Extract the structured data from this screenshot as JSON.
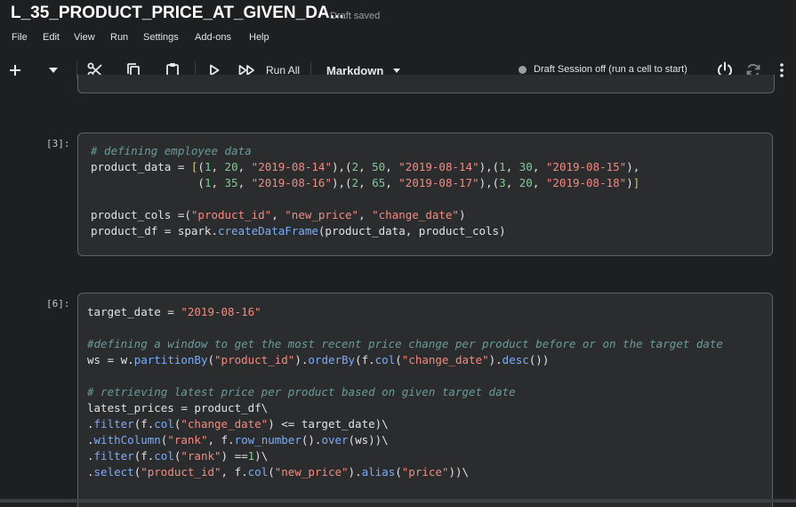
{
  "window": {
    "title": "L_35_PRODUCT_PRICE_AT_GIVEN_DA...",
    "status": "Draft saved"
  },
  "menu": [
    "File",
    "Edit",
    "View",
    "Run",
    "Settings",
    "Add-ons",
    "Help"
  ],
  "toolbar": {
    "add_icon": "plus-icon",
    "run_all_label": "Run All",
    "cell_type": "Markdown",
    "session_text": "Draft Session off (run a cell to start)"
  },
  "cells": [
    {
      "exec_label": "[3]:",
      "lines": [
        "# defining employee data",
        "product_data = [(1, 20, \"2019-08-14\"),(2, 50, \"2019-08-14\"),(1, 30, \"2019-08-15\"),",
        "                (1, 35, \"2019-08-16\"),(2, 65, \"2019-08-17\"),(3, 20, \"2019-08-18\")]",
        "",
        "product_cols =(\"product_id\", \"new_price\", \"change_date\")",
        "product_df = spark.createDataFrame(product_data, product_cols)"
      ]
    },
    {
      "exec_label": "[6]:",
      "lines": [
        "target_date = \"2019-08-16\"",
        "",
        "#defining a window to get the most recent price change per product before or on the target date",
        "ws = w.partitionBy(\"product_id\").orderBy(f.col(\"change_date\").desc())",
        "",
        "# retrieving latest price per product based on given target date",
        "latest_prices = product_df\\",
        ".filter(f.col(\"change_date\") <= target_date)\\",
        ".withColumn(\"rank\", f.row_number().over(ws))\\",
        ".filter(f.col(\"rank\") ==1)\\",
        ".select(\"product_id\", f.col(\"new_price\").alias(\"price\"))\\"
      ]
    }
  ]
}
